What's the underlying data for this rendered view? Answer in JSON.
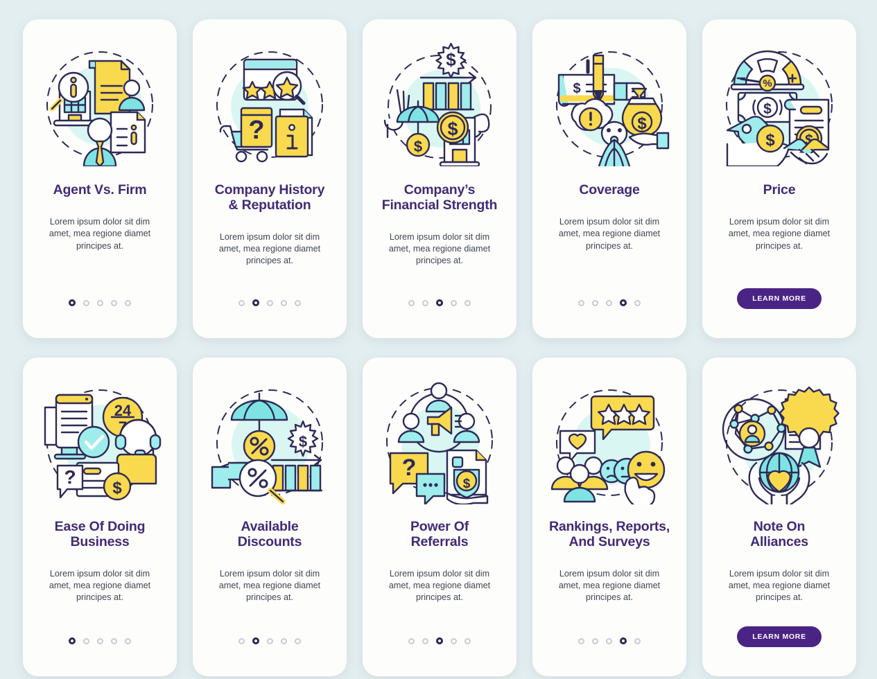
{
  "theme": {
    "background": "#e3eef0",
    "card_background": "#fdfdfb",
    "title_color": "#412a77",
    "body_color": "#3e4654",
    "accent_purple": "#4a2484",
    "dot_active": "#2b2354",
    "dot_inactive": "#c9cbd4",
    "illo_teal": "#7fe3e3",
    "illo_teal_light": "#cdf3f0",
    "illo_yellow": "#f9d94e",
    "illo_outline": "#2d2a56"
  },
  "common": {
    "description": "Lorem ipsum dolor sit dim\namet, mea regione diamet\nprincipes at.",
    "learn_more_label": "LEARN MORE",
    "dot_count": 5
  },
  "cards": [
    {
      "title": "Agent Vs. Firm",
      "icon": "agent-vs-firm-illustration",
      "active_dot": 0,
      "has_button": false
    },
    {
      "title": "Company History\n& Reputation",
      "icon": "company-history-reputation-illustration",
      "active_dot": 1,
      "has_button": false
    },
    {
      "title": "Company’s\nFinancial Strength",
      "icon": "financial-strength-illustration",
      "active_dot": 2,
      "has_button": false
    },
    {
      "title": "Coverage",
      "icon": "coverage-illustration",
      "active_dot": 3,
      "has_button": false
    },
    {
      "title": "Price",
      "icon": "price-illustration",
      "active_dot": 4,
      "has_button": true
    },
    {
      "title": "Ease Of Doing\nBusiness",
      "icon": "ease-of-doing-business-illustration",
      "active_dot": 0,
      "has_button": false
    },
    {
      "title": "Available\nDiscounts",
      "icon": "available-discounts-illustration",
      "active_dot": 1,
      "has_button": false
    },
    {
      "title": "Power Of\nReferrals",
      "icon": "power-of-referrals-illustration",
      "active_dot": 2,
      "has_button": false
    },
    {
      "title": "Rankings, Reports,\nAnd Surveys",
      "icon": "rankings-reports-surveys-illustration",
      "active_dot": 3,
      "has_button": false
    },
    {
      "title": "Note On\nAlliances",
      "icon": "note-on-alliances-illustration",
      "active_dot": 4,
      "has_button": true
    }
  ]
}
